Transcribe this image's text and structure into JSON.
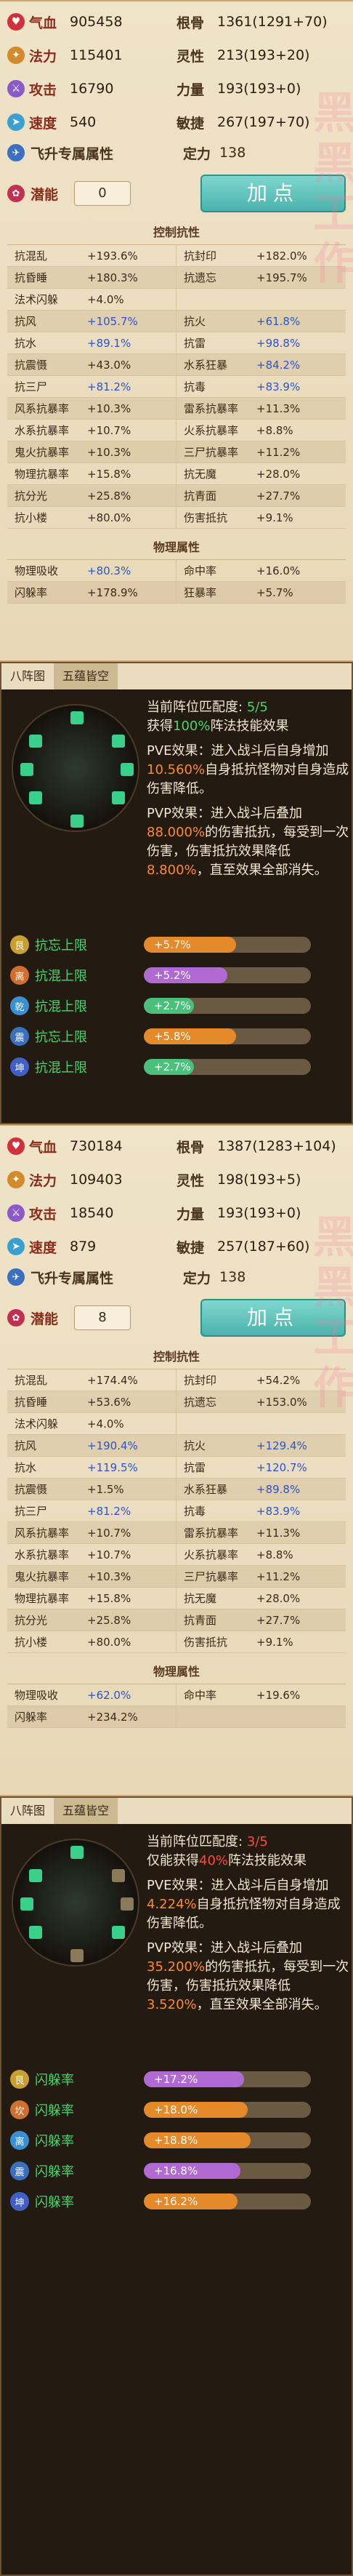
{
  "colors": {
    "accent_teal": "#4bb3ac",
    "label_red": "#8a2c1c",
    "value_blue": "#2b55c7",
    "green_text": "#4cd36e",
    "orange_text": "#ff8a2a",
    "red_text": "#ff4a3a",
    "bar_orange": "#e48a2a",
    "bar_purple": "#b06ad2",
    "bar_green": "#4ac07a"
  },
  "sections": [
    {
      "attrs": [
        {
          "icon": "heart-icon",
          "label": "气血",
          "value": "905458"
        },
        {
          "icon": "bone-icon",
          "label": "根骨",
          "value": "1361(1291+70)"
        },
        {
          "icon": "mana-icon",
          "label": "法力",
          "value": "115401"
        },
        {
          "icon": "spirit-icon",
          "label": "灵性",
          "value": "213(193+20)"
        },
        {
          "icon": "sword-icon",
          "label": "攻击",
          "value": "16790"
        },
        {
          "icon": "strength-icon",
          "label": "力量",
          "value": "193(193+0)"
        },
        {
          "icon": "boot-icon",
          "label": "速度",
          "value": "540"
        },
        {
          "icon": "agility-icon",
          "label": "敏捷",
          "value": "267(197+70)"
        }
      ],
      "fly_label": "飞升专属属性",
      "ding_label": "定力",
      "ding_value": "138",
      "potential_label": "潜能",
      "potential_value": "0",
      "add_label": "加点",
      "resist_title": "控制抗性",
      "resist": [
        [
          "抗混乱",
          "+193.6%",
          "抗封印",
          "+182.0%"
        ],
        [
          "抗昏睡",
          "+180.3%",
          "抗遗忘",
          "+195.7%"
        ],
        [
          "法术闪躲",
          "+4.0%",
          "",
          ""
        ],
        [
          "抗风",
          "+105.7%",
          "抗火",
          "+61.8%"
        ],
        [
          "抗水",
          "+89.1%",
          "抗雷",
          "+98.8%"
        ],
        [
          "抗震慑",
          "+43.0%",
          "水系狂暴",
          "+84.2%"
        ],
        [
          "抗三尸",
          "+81.2%",
          "抗毒",
          "+83.9%"
        ],
        [
          "风系抗暴率",
          "+10.3%",
          "雷系抗暴率",
          "+11.3%"
        ],
        [
          "水系抗暴率",
          "+10.7%",
          "火系抗暴率",
          "+8.8%"
        ],
        [
          "鬼火抗暴率",
          "+10.3%",
          "三尸抗暴率",
          "+11.2%"
        ],
        [
          "物理抗暴率",
          "+15.8%",
          "抗无魔",
          "+28.0%"
        ],
        [
          "抗分光",
          "+25.8%",
          "抗青面",
          "+27.7%"
        ],
        [
          "抗小楼",
          "+80.0%",
          "伤害抵抗",
          "+9.1%"
        ]
      ],
      "phys_title": "物理属性",
      "phys": [
        [
          "物理吸收",
          "+80.3%",
          "命中率",
          "+16.0%"
        ],
        [
          "闪躲率",
          "+178.9%",
          "狂暴率",
          "+5.7%"
        ]
      ]
    },
    {
      "attrs": [
        {
          "icon": "heart-icon",
          "label": "气血",
          "value": "730184"
        },
        {
          "icon": "bone-icon",
          "label": "根骨",
          "value": "1387(1283+104)"
        },
        {
          "icon": "mana-icon",
          "label": "法力",
          "value": "109403"
        },
        {
          "icon": "spirit-icon",
          "label": "灵性",
          "value": "198(193+5)"
        },
        {
          "icon": "sword-icon",
          "label": "攻击",
          "value": "18540"
        },
        {
          "icon": "strength-icon",
          "label": "力量",
          "value": "193(193+0)"
        },
        {
          "icon": "boot-icon",
          "label": "速度",
          "value": "879"
        },
        {
          "icon": "agility-icon",
          "label": "敏捷",
          "value": "257(187+60)"
        }
      ],
      "fly_label": "飞升专属属性",
      "ding_label": "定力",
      "ding_value": "138",
      "potential_label": "潜能",
      "potential_value": "8",
      "add_label": "加点",
      "resist_title": "控制抗性",
      "resist": [
        [
          "抗混乱",
          "+174.4%",
          "抗封印",
          "+54.2%"
        ],
        [
          "抗昏睡",
          "+53.6%",
          "抗遗忘",
          "+153.0%"
        ],
        [
          "法术闪躲",
          "+4.0%",
          "",
          ""
        ],
        [
          "抗风",
          "+190.4%",
          "抗火",
          "+129.4%"
        ],
        [
          "抗水",
          "+119.5%",
          "抗雷",
          "+120.7%"
        ],
        [
          "抗震慑",
          "+1.5%",
          "水系狂暴",
          "+89.8%"
        ],
        [
          "抗三尸",
          "+81.2%",
          "抗毒",
          "+83.9%"
        ],
        [
          "风系抗暴率",
          "+10.7%",
          "雷系抗暴率",
          "+11.3%"
        ],
        [
          "水系抗暴率",
          "+10.7%",
          "火系抗暴率",
          "+8.8%"
        ],
        [
          "鬼火抗暴率",
          "+10.3%",
          "三尸抗暴率",
          "+11.2%"
        ],
        [
          "物理抗暴率",
          "+15.8%",
          "抗无魔",
          "+28.0%"
        ],
        [
          "抗分光",
          "+25.8%",
          "抗青面",
          "+27.7%"
        ],
        [
          "抗小楼",
          "+80.0%",
          "伤害抵抗",
          "+9.1%"
        ]
      ],
      "phys_title": "物理属性",
      "phys": [
        [
          "物理吸收",
          "+62.0%",
          "命中率",
          "+19.6%"
        ],
        [
          "闪躲率",
          "+234.2%",
          "",
          ""
        ]
      ]
    }
  ],
  "formations": [
    {
      "tab1": "八阵图",
      "tab2": "五蕴皆空",
      "match_label": "当前阵位匹配度:",
      "match_value": "5/5",
      "gain_pre": "获得",
      "gain_pct": "100%",
      "gain_post": "阵法技能效果",
      "pve_pre": "PVE效果：进入战斗后自身增加",
      "pve_pct": "10.560%",
      "pve_post": "自身抵抗怪物对自身造成伤害降低。",
      "pvp_pre": "PVP效果：进入战斗后叠加",
      "pvp_pct": "88.000%",
      "pvp_mid": "的伤害抵抗，每受到一次伤害，伤害抵抗效果降低",
      "pvp_pct2": "8.800%",
      "pvp_post": "，直至效果全部消失。",
      "rows": [
        {
          "badge": "艮",
          "label": "抗忘上限",
          "value": "+5.7%",
          "fill": 0.55,
          "bar": "orange"
        },
        {
          "badge": "离",
          "label": "抗混上限",
          "value": "+5.2%",
          "fill": 0.5,
          "bar": "purple"
        },
        {
          "badge": "乾",
          "label": "抗混上限",
          "value": "+2.7%",
          "fill": 0.3,
          "bar": "green"
        },
        {
          "badge": "震",
          "label": "抗忘上限",
          "value": "+5.8%",
          "fill": 0.55,
          "bar": "orange"
        },
        {
          "badge": "坤",
          "label": "抗混上限",
          "value": "+2.7%",
          "fill": 0.3,
          "bar": "green"
        }
      ]
    },
    {
      "tab1": "八阵图",
      "tab2": "五蕴皆空",
      "match_label": "当前阵位匹配度:",
      "match_value": "3/5",
      "gain_pre": "仅能获得",
      "gain_pct": "40%",
      "gain_post": "阵法技能效果",
      "pve_pre": "PVE效果：进入战斗后自身增加",
      "pve_pct": "4.224%",
      "pve_post": "自身抵抗怪物对自身造成伤害降低。",
      "pvp_pre": "PVP效果：进入战斗后叠加",
      "pvp_pct": "35.200%",
      "pvp_mid": "的伤害抵抗，每受到一次伤害，伤害抵抗效果降低",
      "pvp_pct2": "3.520%",
      "pvp_post": "，直至效果全部消失。",
      "rows": [
        {
          "badge": "艮",
          "label": "闪躲率",
          "value": "+17.2%",
          "fill": 0.6,
          "bar": "purple"
        },
        {
          "badge": "坎",
          "label": "闪躲率",
          "value": "+18.0%",
          "fill": 0.62,
          "bar": "orange"
        },
        {
          "badge": "离",
          "label": "闪躲率",
          "value": "+18.8%",
          "fill": 0.64,
          "bar": "orange"
        },
        {
          "badge": "震",
          "label": "闪躲率",
          "value": "+16.8%",
          "fill": 0.58,
          "bar": "purple"
        },
        {
          "badge": "坤",
          "label": "闪躲率",
          "value": "+16.2%",
          "fill": 0.56,
          "bar": "orange"
        }
      ]
    }
  ]
}
